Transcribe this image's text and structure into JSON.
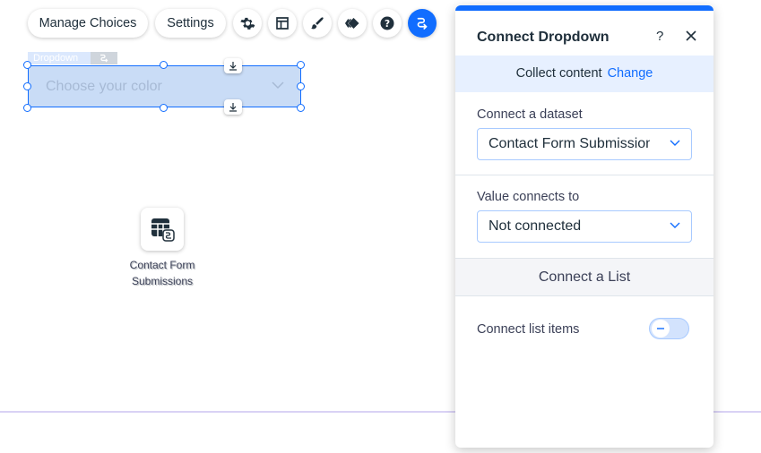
{
  "toolbar": {
    "manage_choices": "Manage Choices",
    "settings": "Settings"
  },
  "canvas": {
    "tag_label": "Dropdown",
    "dropdown_placeholder": "Choose your color",
    "dataset_label": "Contact Form Submissions"
  },
  "panel": {
    "title": "Connect Dropdown",
    "help": "?",
    "collect_text": "Collect content",
    "change_link": "Change",
    "dataset_label": "Connect a dataset",
    "dataset_value": "Contact Form Submissions",
    "value_label": "Value connects to",
    "value_value": "Not connected",
    "list_header": "Connect a List",
    "list_items_label": "Connect list items",
    "list_items_enabled": false
  },
  "colors": {
    "accent": "#116dff",
    "panel_highlight": "#e7f0ff"
  }
}
